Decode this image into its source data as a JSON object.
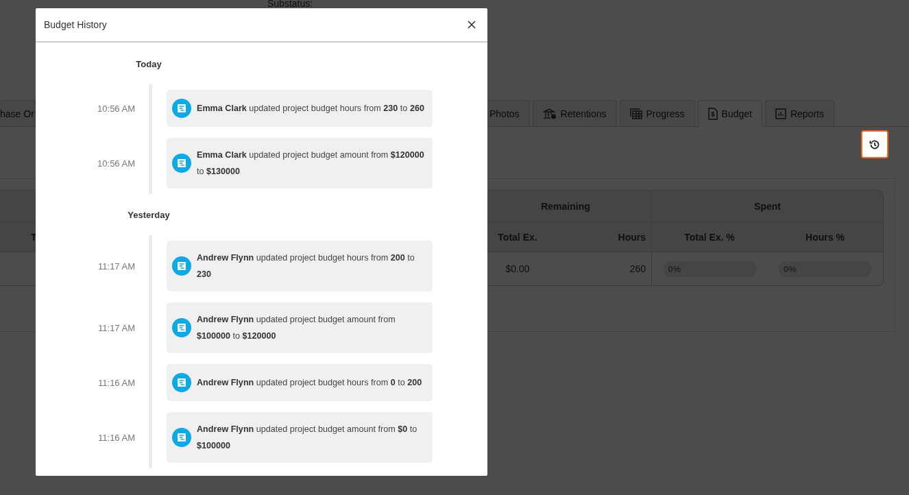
{
  "page": {
    "substatus_label": "Substatus:",
    "tabs": [
      {
        "label": "hase Or",
        "kind": "plain",
        "selected": false
      },
      {
        "label": "Photos",
        "kind": "plain",
        "selected": false
      },
      {
        "label": "Retentions",
        "kind": "bank",
        "selected": false
      },
      {
        "label": "Progress",
        "kind": "table",
        "selected": false
      },
      {
        "label": "Budget",
        "kind": "invoice",
        "selected": true
      },
      {
        "label": "Reports",
        "kind": "chart",
        "selected": false
      }
    ],
    "budget_table": {
      "first_column_fragment": "T",
      "groups": [
        "Remaining",
        "Spent"
      ],
      "columns": [
        "Total Ex.",
        "Hours",
        "Total Ex. %",
        "Hours %"
      ],
      "row": {
        "total_ex": "$0.00",
        "hours": "260",
        "spent": [
          {
            "level": 0,
            "label": "0%"
          },
          {
            "level": 0,
            "label": "0%"
          }
        ]
      }
    }
  },
  "history_button": {
    "highlighted": true
  },
  "dialog": {
    "title": "Budget History",
    "groups": [
      {
        "label": "Today",
        "entries": [
          {
            "time": "10:56 AM",
            "text": "**Emma Clark** updated project budget hours from **230** to **260**"
          },
          {
            "time": "10:56 AM",
            "text": "**Emma Clark** updated project budget amount from **$120000** to **$130000**"
          }
        ]
      },
      {
        "label": "Yesterday",
        "entries": [
          {
            "time": "11:17 AM",
            "text": "**Andrew Flynn** updated project budget hours from **200** to **230**"
          },
          {
            "time": "11:17 AM",
            "text": "**Andrew Flynn** updated project budget amount from **$100000** to **$120000**"
          },
          {
            "time": "11:16 AM",
            "text": "**Andrew Flynn** updated project budget hours from **0** to **200**"
          },
          {
            "time": "11:16 AM",
            "text": "**Andrew Flynn** updated project budget amount from **$0** to **$100000**"
          }
        ]
      }
    ]
  }
}
